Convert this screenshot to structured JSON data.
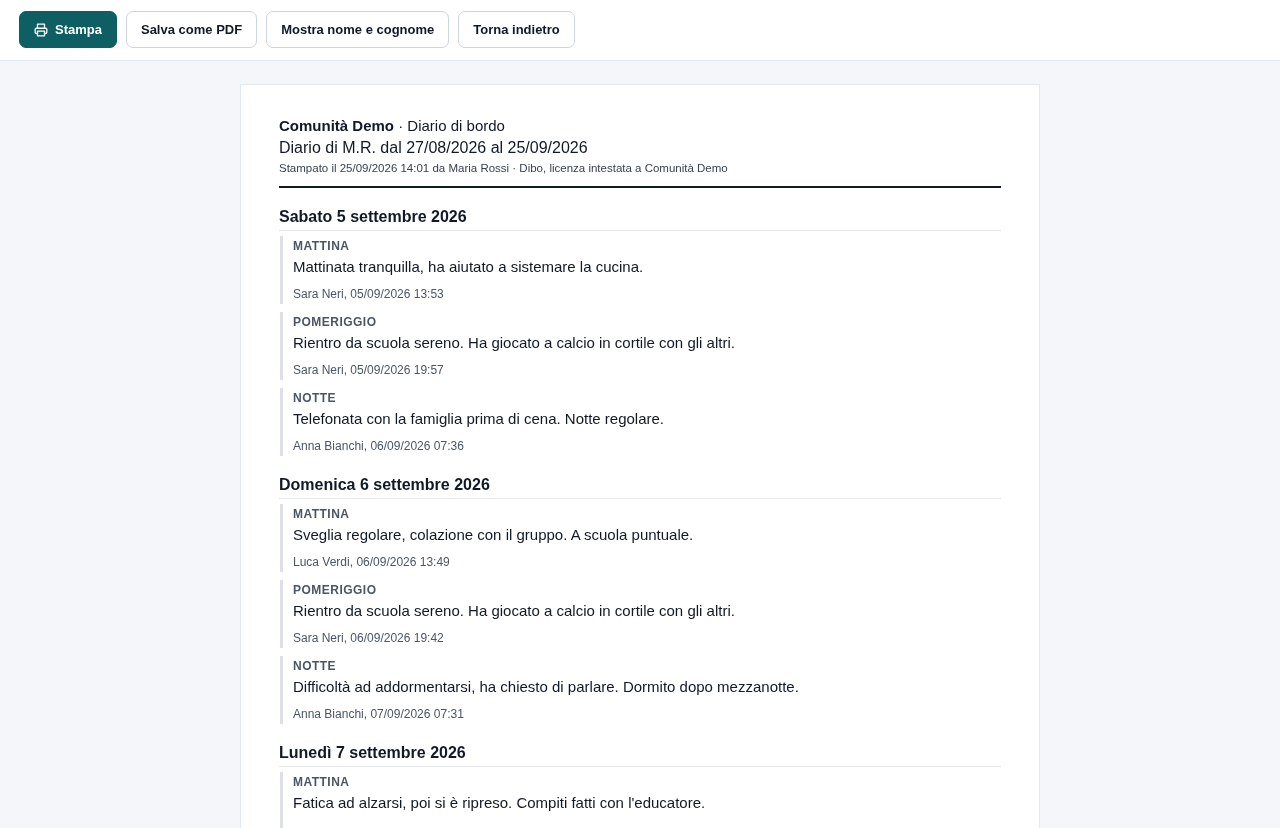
{
  "toolbar": {
    "buttons": [
      {
        "label": "Stampa",
        "kind": "primary"
      },
      {
        "label": "Salva come PDF",
        "kind": "secondary"
      },
      {
        "label": "Mostra nome e cognome",
        "kind": "secondary"
      },
      {
        "label": "Torna indietro",
        "kind": "secondary"
      }
    ]
  },
  "document": {
    "header": {
      "line": "**Comunità Demo** · Diario di bordo",
      "subtitle": "Diario di M.R. dal 27/08/2026 al 25/09/2026",
      "printed_note": "Stampato il 25/09/2026 14:01 da Maria Rossi · Dibo, licenza intestata a Comunità Demo"
    },
    "days": [
      {
        "heading": "Sabato 5 settembre 2026",
        "entries": [
          {
            "shift": "MATTINA",
            "text": "Mattinata tranquilla, ha aiutato a sistemare la cucina.",
            "author": "Sara Neri, 05/09/2026 13:53"
          },
          {
            "shift": "POMERIGGIO",
            "text": "Rientro da scuola sereno. Ha giocato a calcio in cortile con gli altri.",
            "author": "Sara Neri, 05/09/2026 19:57"
          },
          {
            "shift": "NOTTE",
            "text": "Telefonata con la famiglia prima di cena. Notte regolare.",
            "author": "Anna Bianchi, 06/09/2026 07:36"
          }
        ]
      },
      {
        "heading": "Domenica 6 settembre 2026",
        "entries": [
          {
            "shift": "MATTINA",
            "text": "Sveglia regolare, colazione con il gruppo. A scuola puntuale.",
            "author": "Luca Verdi, 06/09/2026 13:49"
          },
          {
            "shift": "POMERIGGIO",
            "text": "Rientro da scuola sereno. Ha giocato a calcio in cortile con gli altri.",
            "author": "Sara Neri, 06/09/2026 19:42"
          },
          {
            "shift": "NOTTE",
            "text": "Difficoltà ad addormentarsi, ha chiesto di parlare. Dormito dopo mezzanotte.",
            "author": "Anna Bianchi, 07/09/2026 07:31"
          }
        ]
      },
      {
        "heading": "Lunedì 7 settembre 2026",
        "entries": [
          {
            "shift": "MATTINA",
            "text": "Fatica ad alzarsi, poi si è ripreso. Compiti fatti con l'educatore."
          }
        ]
      }
    ]
  }
}
